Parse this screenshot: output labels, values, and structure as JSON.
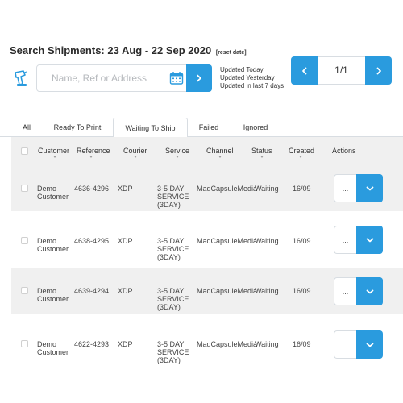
{
  "header": {
    "title": "Search Shipments: 23 Aug - 22 Sep 2020",
    "reset_label": "[reset date]"
  },
  "search": {
    "placeholder": "Name, Ref or Address",
    "value": ""
  },
  "updated_filters": [
    "Updated Today",
    "Updated Yesterday",
    "Updated in last 7 days"
  ],
  "pagination": {
    "page_label": "1/1"
  },
  "tabs": [
    {
      "label": "All"
    },
    {
      "label": "Ready To Print"
    },
    {
      "label": "Waiting To Ship"
    },
    {
      "label": "Failed"
    },
    {
      "label": "Ignored"
    }
  ],
  "active_tab": "Waiting To Ship",
  "table": {
    "columns": [
      "Customer",
      "Reference",
      "Courier",
      "Service",
      "Channel",
      "Status",
      "Created",
      "Actions"
    ],
    "rows": [
      {
        "customer": [
          "Demo",
          "Customer"
        ],
        "reference": "4636-4296",
        "courier": "XDP",
        "service": [
          "3-5 DAY",
          "SERVICE",
          "(3DAY)"
        ],
        "channel": "MadCapsuleMedia",
        "status": "Waiting",
        "created": "16/09",
        "more_label": "..."
      },
      {
        "customer": [
          "Demo",
          "Customer"
        ],
        "reference": "4638-4295",
        "courier": "XDP",
        "service": [
          "3-5 DAY",
          "SERVICE",
          "(3DAY)"
        ],
        "channel": "MadCapsuleMedia",
        "status": "Waiting",
        "created": "16/09",
        "more_label": "..."
      },
      {
        "customer": [
          "Demo",
          "Customer"
        ],
        "reference": "4639-4294",
        "courier": "XDP",
        "service": [
          "3-5 DAY",
          "SERVICE",
          "(3DAY)"
        ],
        "channel": "MadCapsuleMedia",
        "status": "Waiting",
        "created": "16/09",
        "more_label": "..."
      },
      {
        "customer": [
          "Demo",
          "Customer"
        ],
        "reference": "4622-4293",
        "courier": "XDP",
        "service": [
          "3-5 DAY",
          "SERVICE",
          "(3DAY)"
        ],
        "channel": "MadCapsuleMedia",
        "status": "Waiting",
        "created": "16/09",
        "more_label": "..."
      }
    ]
  },
  "colors": {
    "accent": "#2a9bde",
    "row_shade": "#f0f0f0",
    "border": "#d8dde2"
  },
  "icons": {
    "scanner": "barcode-scanner-icon",
    "calendar": "calendar-icon",
    "search_go": "chevron-right-icon",
    "prev": "chevron-left-icon",
    "next": "chevron-right-icon",
    "row_dropdown": "chevron-down-icon"
  }
}
